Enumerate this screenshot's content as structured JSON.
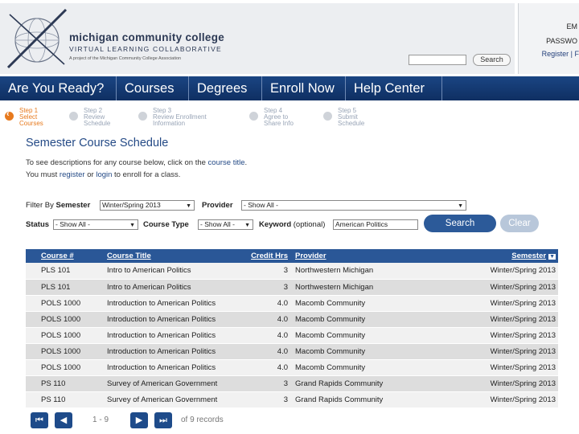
{
  "header": {
    "brand_name": "michigan community college",
    "brand_sub": "VIRTUAL LEARNING COLLABORATIVE",
    "brand_tag": "A project of the Michigan Community College Association",
    "login_email_label": "EM",
    "login_password_label": "PASSWO",
    "login_links": "Register | F",
    "search_button": "Search"
  },
  "nav": {
    "items": [
      "Are You Ready?",
      "Courses",
      "Degrees",
      "Enroll Now",
      "Help Center"
    ]
  },
  "steps": [
    {
      "line1": "Step 1",
      "line2": "Select",
      "line3": "Courses",
      "active": true
    },
    {
      "line1": "Step 2",
      "line2": "Review",
      "line3": "Schedule",
      "active": false
    },
    {
      "line1": "Step 3",
      "line2": "Review Enrollment",
      "line3": "Information",
      "active": false
    },
    {
      "line1": "Step 4",
      "line2": "Agree to",
      "line3": "Share Info",
      "active": false
    },
    {
      "line1": "Step 5",
      "line2": "Submit",
      "line3": "Schedule",
      "active": false
    }
  ],
  "page": {
    "title": "Semester Course Schedule",
    "intro1_pre": "To see descriptions for any course below, click on the ",
    "intro1_link": "course title",
    "intro1_post": ".",
    "intro2_pre": "You must ",
    "intro2_link1": "register",
    "intro2_mid": " or ",
    "intro2_link2": "login",
    "intro2_post": " to enroll for a class."
  },
  "filters": {
    "filter_by": "Filter By",
    "semester_label": "Semester",
    "semester_value": "Winter/Spring 2013",
    "provider_label": "Provider",
    "provider_value": "- Show All -",
    "status_label": "Status",
    "status_value": "- Show All -",
    "course_type_label": "Course Type",
    "course_type_value": "- Show All -",
    "keyword_label": "Keyword",
    "keyword_optional": "(optional)",
    "keyword_value": "American Politics",
    "search_button": "Search",
    "clear_button": "Clear"
  },
  "table": {
    "headers": [
      "Course #",
      "Course Title",
      "Credit Hrs",
      "Provider",
      "Semester"
    ],
    "rows": [
      [
        "PLS 101",
        "Intro to American Politics",
        "3",
        "Northwestern Michigan",
        "Winter/Spring 2013"
      ],
      [
        "PLS 101",
        "Intro to American Politics",
        "3",
        "Northwestern Michigan",
        "Winter/Spring 2013"
      ],
      [
        "POLS 1000",
        "Introduction to American Politics",
        "4.0",
        "Macomb Community",
        "Winter/Spring 2013"
      ],
      [
        "POLS 1000",
        "Introduction to American Politics",
        "4.0",
        "Macomb Community",
        "Winter/Spring 2013"
      ],
      [
        "POLS 1000",
        "Introduction to American Politics",
        "4.0",
        "Macomb Community",
        "Winter/Spring 2013"
      ],
      [
        "POLS 1000",
        "Introduction to American Politics",
        "4.0",
        "Macomb Community",
        "Winter/Spring 2013"
      ],
      [
        "POLS 1000",
        "Introduction to American Politics",
        "4.0",
        "Macomb Community",
        "Winter/Spring 2013"
      ],
      [
        "PS 110",
        "Survey of American Government",
        "3",
        "Grand Rapids Community",
        "Winter/Spring 2013"
      ],
      [
        "PS 110",
        "Survey of American Government",
        "3",
        "Grand Rapids Community",
        "Winter/Spring 2013"
      ]
    ]
  },
  "pagination": {
    "range": "1 - 9",
    "total": "of 9 records"
  },
  "colors": {
    "nav": "#1a4583",
    "accent_orange": "#e77a1e",
    "table_header": "#2a5797"
  }
}
